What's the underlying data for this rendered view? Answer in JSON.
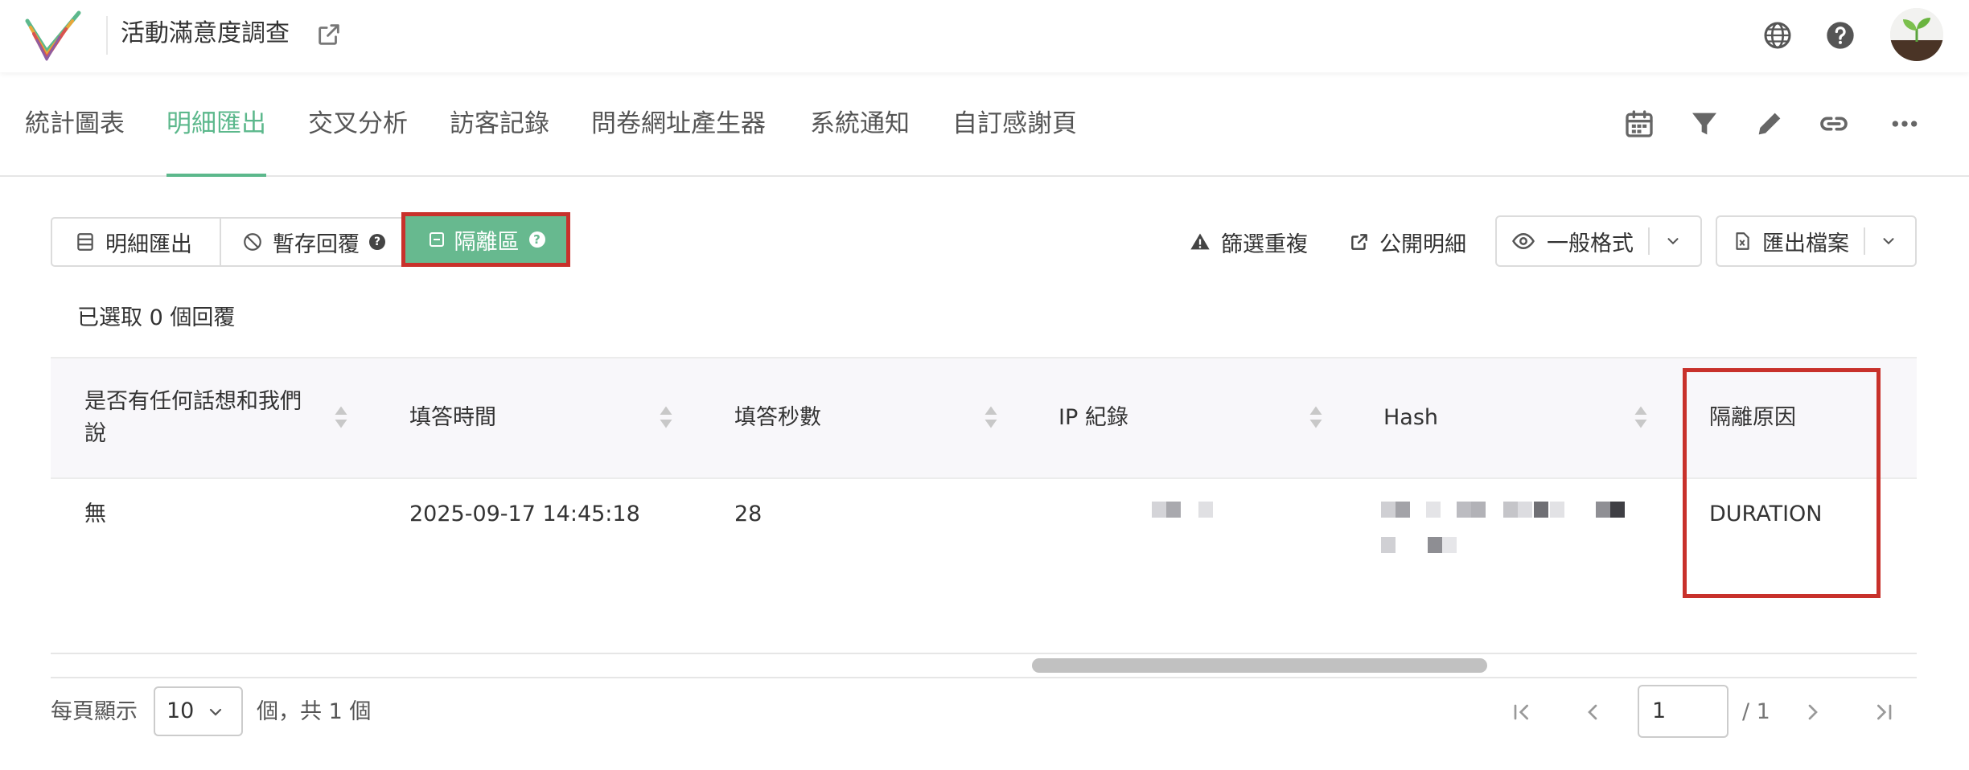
{
  "header": {
    "title": "活動滿意度調查"
  },
  "tabs": [
    {
      "label": "統計圖表"
    },
    {
      "label": "明細匯出"
    },
    {
      "label": "交叉分析"
    },
    {
      "label": "訪客記錄"
    },
    {
      "label": "問卷網址產生器"
    },
    {
      "label": "系統通知"
    },
    {
      "label": "自訂感謝頁"
    }
  ],
  "toolbar": {
    "detail_export": "明細匯出",
    "draft_reply": "暫存回覆",
    "quarantine": "隔離區",
    "filter_duplicates": "篩選重複",
    "public_detail": "公開明細",
    "format": "一般格式",
    "export_file": "匯出檔案"
  },
  "selection": {
    "text": "已選取 0 個回覆"
  },
  "table": {
    "columns": [
      {
        "label": "是否有任何話想和我們說"
      },
      {
        "label": "填答時間"
      },
      {
        "label": "填答秒數"
      },
      {
        "label": "IP 紀錄"
      },
      {
        "label": "Hash"
      },
      {
        "label": "隔離原因"
      }
    ],
    "rows": [
      {
        "comment": "無",
        "time": "2025-09-17 14:45:18",
        "seconds": "28",
        "reason": "DURATION"
      }
    ]
  },
  "pagination": {
    "per_page_label": "每頁顯示",
    "per_page_value": "10",
    "total_label": "個，共 1 個",
    "current_page": "1",
    "page_total": "/ 1"
  },
  "colors": {
    "accent": "#5cb88c",
    "quarantine_bg": "#67b98f",
    "highlight_border": "#c8312b"
  }
}
